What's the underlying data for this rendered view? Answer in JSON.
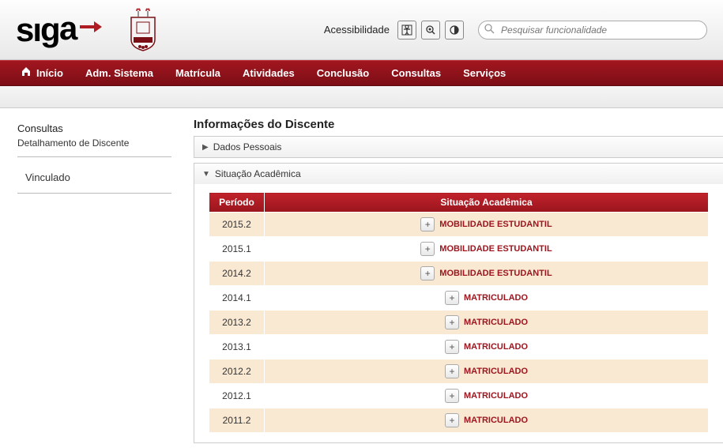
{
  "header": {
    "accessibility_label": "Acessibilidade",
    "search_placeholder": "Pesquisar funcionalidade"
  },
  "nav": {
    "items": [
      "Início",
      "Adm. Sistema",
      "Matrícula",
      "Atividades",
      "Conclusão",
      "Consultas",
      "Serviços"
    ]
  },
  "sidebar": {
    "section_title": "Consultas",
    "section_sub": "Detalhamento de Discente",
    "status_item": "Vinculado"
  },
  "main": {
    "page_title": "Informações do Discente",
    "panel_personal": "Dados Pessoais",
    "panel_academic": "Situação Acadêmica",
    "table": {
      "col_period": "Período",
      "col_status": "Situação Acadêmica",
      "rows": [
        {
          "period": "2015.2",
          "status": "MOBILIDADE ESTUDANTIL"
        },
        {
          "period": "2015.1",
          "status": "MOBILIDADE ESTUDANTIL"
        },
        {
          "period": "2014.2",
          "status": "MOBILIDADE ESTUDANTIL"
        },
        {
          "period": "2014.1",
          "status": "MATRICULADO"
        },
        {
          "period": "2013.2",
          "status": "MATRICULADO"
        },
        {
          "period": "2013.1",
          "status": "MATRICULADO"
        },
        {
          "period": "2012.2",
          "status": "MATRICULADO"
        },
        {
          "period": "2012.1",
          "status": "MATRICULADO"
        },
        {
          "period": "2011.2",
          "status": "MATRICULADO"
        }
      ]
    }
  }
}
